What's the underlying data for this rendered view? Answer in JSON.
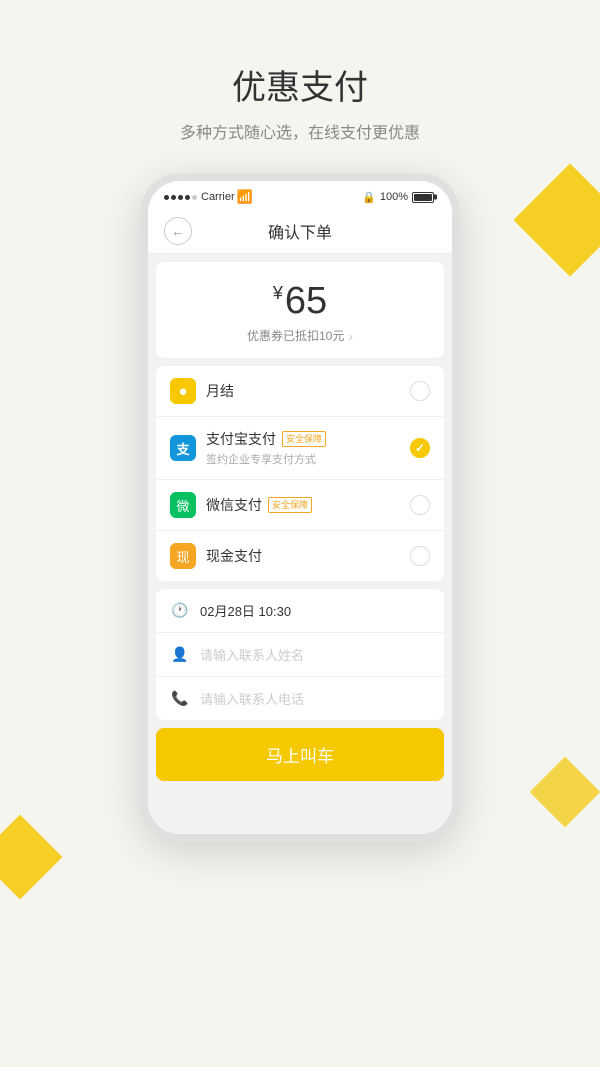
{
  "page": {
    "title": "优惠支付",
    "subtitle": "多种方式随心选，在线支付更优惠"
  },
  "status_bar": {
    "dots": [
      "filled",
      "filled",
      "filled",
      "filled",
      "empty"
    ],
    "carrier": "Carrier",
    "wifi": "WiFi",
    "lock": "🔒",
    "battery_pct": "100%"
  },
  "nav": {
    "back_icon": "←",
    "title": "确认下单"
  },
  "price": {
    "currency_symbol": "¥",
    "amount": "65",
    "discount_text": "优惠券已抵扣10元",
    "arrow": "›"
  },
  "payment_methods": [
    {
      "id": "monthly",
      "icon": "●",
      "icon_class": "icon-monthly",
      "name": "月结",
      "sub": "",
      "badge": "",
      "selected": false
    },
    {
      "id": "alipay",
      "icon": "支",
      "icon_class": "icon-alipay",
      "name": "支付宝支付",
      "sub": "签约企业专享支付方式",
      "badge": "安全保障",
      "selected": true
    },
    {
      "id": "wechat",
      "icon": "微",
      "icon_class": "icon-wechat",
      "name": "微信支付",
      "sub": "",
      "badge": "安全保障",
      "selected": false
    },
    {
      "id": "cash",
      "icon": "现",
      "icon_class": "icon-cash",
      "name": "现金支付",
      "sub": "",
      "badge": "",
      "selected": false
    }
  ],
  "info_fields": [
    {
      "icon": "🕐",
      "value": "02月28日 10:30",
      "placeholder": false
    },
    {
      "icon": "👤",
      "value": "请输入联系人姓名",
      "placeholder": true
    },
    {
      "icon": "📞",
      "value": "请输入联系人电话",
      "placeholder": true
    }
  ],
  "submit_button": {
    "label": "马上叫车"
  }
}
